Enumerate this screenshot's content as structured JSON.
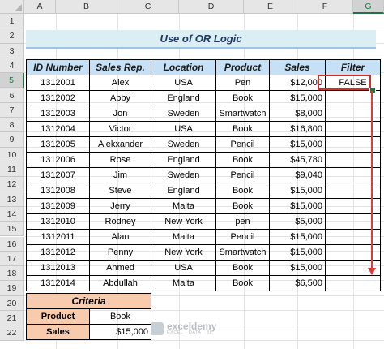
{
  "columns": [
    "A",
    "B",
    "C",
    "D",
    "E",
    "F",
    "G"
  ],
  "rows": [
    "1",
    "2",
    "3",
    "4",
    "5",
    "6",
    "7",
    "8",
    "9",
    "10",
    "11",
    "12",
    "13",
    "14",
    "15",
    "16",
    "17",
    "18",
    "19",
    "20",
    "21",
    "22"
  ],
  "selected": {
    "column": "G",
    "row": "5"
  },
  "title": "Use of OR Logic",
  "table": {
    "headers": [
      "ID Number",
      "Sales Rep.",
      "Location",
      "Product",
      "Sales",
      "Filter"
    ],
    "rows": [
      [
        "1312001",
        "Alex",
        "USA",
        "Pen",
        "$12,000",
        "FALSE"
      ],
      [
        "1312002",
        "Abby",
        "England",
        "Book",
        "$15,000",
        ""
      ],
      [
        "1312003",
        "Jon",
        "Sweden",
        "Smartwatch",
        "$8,000",
        ""
      ],
      [
        "1312004",
        "Victor",
        "USA",
        "Book",
        "$16,800",
        ""
      ],
      [
        "1312005",
        "Alekxander",
        "Sweden",
        "Pencil",
        "$15,000",
        ""
      ],
      [
        "1312006",
        "Rose",
        "England",
        "Book",
        "$45,780",
        ""
      ],
      [
        "1312007",
        "Jim",
        "Sweden",
        "Pencil",
        "$9,040",
        ""
      ],
      [
        "1312008",
        "Steve",
        "England",
        "Book",
        "$15,000",
        ""
      ],
      [
        "1312009",
        "Jerry",
        "Malta",
        "Book",
        "$15,000",
        ""
      ],
      [
        "1312010",
        "Rodney",
        "New York",
        "pen",
        "$5,000",
        ""
      ],
      [
        "1312011",
        "Alan",
        "Malta",
        "Pencil",
        "$15,000",
        ""
      ],
      [
        "1312012",
        "Penny",
        "New York",
        "Smartwatch",
        "$15,000",
        ""
      ],
      [
        "1312013",
        "Ahmed",
        "USA",
        "Book",
        "$15,000",
        ""
      ],
      [
        "1312014",
        "Abdullah",
        "Malta",
        "Book",
        "$6,500",
        ""
      ]
    ]
  },
  "criteria": {
    "title": "Criteria",
    "rows": [
      {
        "label": "Product",
        "value": "Book"
      },
      {
        "label": "Sales",
        "value": "$15,000"
      }
    ]
  },
  "watermark": {
    "name": "exceldemy",
    "tagline": "EXCEL · DATA · BI"
  },
  "colors": {
    "header_fill": "#c6e0f5",
    "title_fill": "#dbeef4",
    "criteria_fill": "#f8cbad",
    "arrow": "#e53935",
    "accent": "#217346"
  }
}
